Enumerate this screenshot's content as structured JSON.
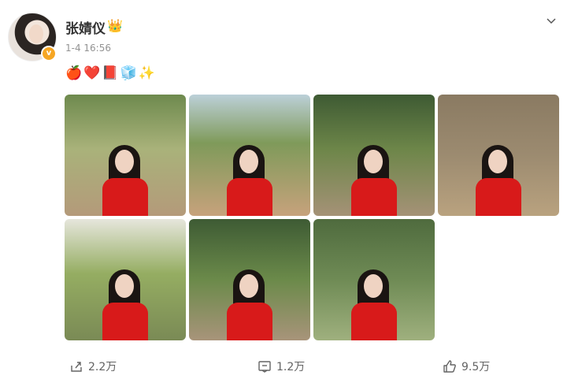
{
  "post": {
    "author": "张婧仪",
    "time": "1-4 16:56",
    "text": "🍎❤️📕🧊✨"
  },
  "photos": [
    {
      "bg": "linear-gradient(180deg,#6e8a4e 0%,#a9b27a 45%,#b49a7a 100%)"
    },
    {
      "bg": "linear-gradient(180deg,#bcd0d8 0%,#7f9a5a 40%,#c7a27c 100%)"
    },
    {
      "bg": "linear-gradient(180deg,#3e5a33 0%,#6d8649 45%,#a59277 100%)"
    },
    {
      "bg": "linear-gradient(180deg,#8a7a62 0%,#9c8b70 50%,#b9a27f 100%)"
    },
    {
      "bg": "linear-gradient(180deg,#e6e6dc 0%,#95ad62 45%,#7a8a55 100%)"
    },
    {
      "bg": "linear-gradient(180deg,#3e5b34 0%,#6b8a4a 50%,#a8947a 100%)"
    },
    {
      "bg": "linear-gradient(180deg,#4f6b3e 0%,#6f8b55 50%,#9fb07e 100%)"
    }
  ],
  "actions": {
    "share_count": "2.2万",
    "comment_count": "1.2万",
    "like_count": "9.5万"
  },
  "colors": {
    "accent_red": "#d81a1a",
    "muted_text": "#939393"
  }
}
